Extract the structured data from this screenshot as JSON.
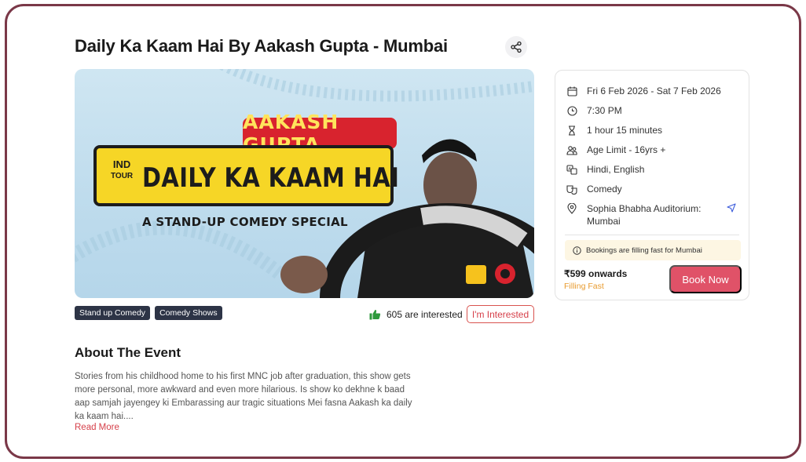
{
  "event": {
    "title": "Daily Ka Kaam Hai By Aakash Gupta - Mumbai",
    "share_icon": "share-icon"
  },
  "banner": {
    "name_tag": "AAKASH GUPTA",
    "plate_prefix": "IND",
    "plate_prefix_small": "TOUR",
    "plate_title": "DAILY KA KAAM HAI",
    "subtitle": "A STAND-UP COMEDY SPECIAL"
  },
  "tags": [
    "Stand up Comedy",
    "Comedy Shows"
  ],
  "interest": {
    "count_text": "605 are interested",
    "button_label": "I'm Interested"
  },
  "about": {
    "heading": "About The Event",
    "text": "Stories from his childhood home to his first MNC job after graduation, this show gets more personal, more awkward and even more hilarious. Is show ko dekhne k baad aap samjah jayengey ki Embarassing aur tragic situations Mei fasna Aakash ka daily ka kaam hai....",
    "read_more": "Read More"
  },
  "info": {
    "date": "Fri 6 Feb 2026 - Sat 7 Feb 2026",
    "time": "7:30 PM",
    "duration": "1 hour 15 minutes",
    "age_limit": "Age Limit - 16yrs +",
    "languages": "Hindi, English",
    "genre": "Comedy",
    "venue_line1": "Sophia Bhabha Auditorium:",
    "venue_line2": "Mumbai",
    "alert": "Bookings are filling fast for Mumbai",
    "price": "₹599 onwards",
    "price_status": "Filling Fast",
    "book_label": "Book Now"
  },
  "colors": {
    "accent": "#e05268",
    "frame": "#7a3848",
    "chip_bg": "#2d3446",
    "filling_fast": "#e89b2f"
  }
}
